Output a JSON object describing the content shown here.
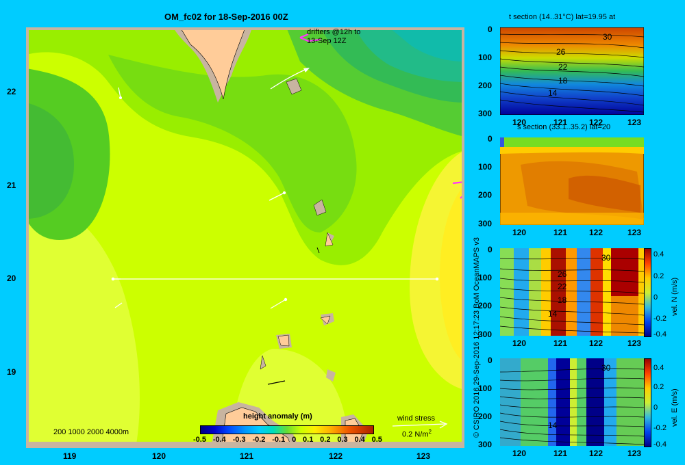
{
  "main_map": {
    "title": "OM_fc02 for 18-Sep-2016 00Z",
    "drifters_label": "drifters @12h to",
    "drifters_label2": "13-Sep 12Z",
    "depth_legend": "200  1000  2000  4000m",
    "x_ticks": [
      "119",
      "120",
      "121",
      "122",
      "123"
    ],
    "y_ticks": [
      "22",
      "21",
      "20",
      "19"
    ],
    "colorbar_title": "height anomaly  (m)",
    "colorbar_ticks": [
      "-0.5",
      "-0.4",
      "-0.3",
      "-0.2",
      "-0.1",
      "0",
      "0.1",
      "0.2",
      "0.3",
      "0.4",
      "0.5"
    ],
    "wind_stress_label": "wind stress",
    "wind_stress_scale": "0.2 N/m",
    "wind_stress_exp": "2"
  },
  "credit": "© CSIRO 2016   29-Sep-2016 12:17:23 BoM OceanMAPS v3",
  "panels": [
    {
      "title": "t section (14..31°C) lat=19.95 at",
      "y_ticks": [
        "0",
        "100",
        "200",
        "300"
      ],
      "x_ticks": [
        "120",
        "121",
        "122",
        "123"
      ],
      "contour_labels": [
        "30",
        "26",
        "22",
        "18",
        "14"
      ]
    },
    {
      "title": "s section (33.1..35.2) lat=20",
      "y_ticks": [
        "0",
        "100",
        "200",
        "300"
      ],
      "x_ticks": [
        "120",
        "121",
        "122",
        "123"
      ]
    },
    {
      "title": "",
      "y_ticks": [
        "0",
        "100",
        "200",
        "300"
      ],
      "x_ticks": [
        "120",
        "121",
        "122",
        "123"
      ],
      "contour_labels": [
        "30",
        "26",
        "22",
        "18",
        "14"
      ],
      "cb_label": "vel. N (m/s)",
      "cb_ticks": [
        "0.4",
        "0.2",
        "0",
        "-0.2",
        "-0.4"
      ]
    },
    {
      "title": "",
      "y_ticks": [
        "0",
        "100",
        "200",
        "300"
      ],
      "x_ticks": [
        "120",
        "121",
        "122",
        "123"
      ],
      "contour_labels": [
        "30",
        "14"
      ],
      "cb_label": "vel. E (m/s)",
      "cb_ticks": [
        "0.4",
        "0.2",
        "0",
        "-0.2",
        "-0.4"
      ]
    }
  ]
}
